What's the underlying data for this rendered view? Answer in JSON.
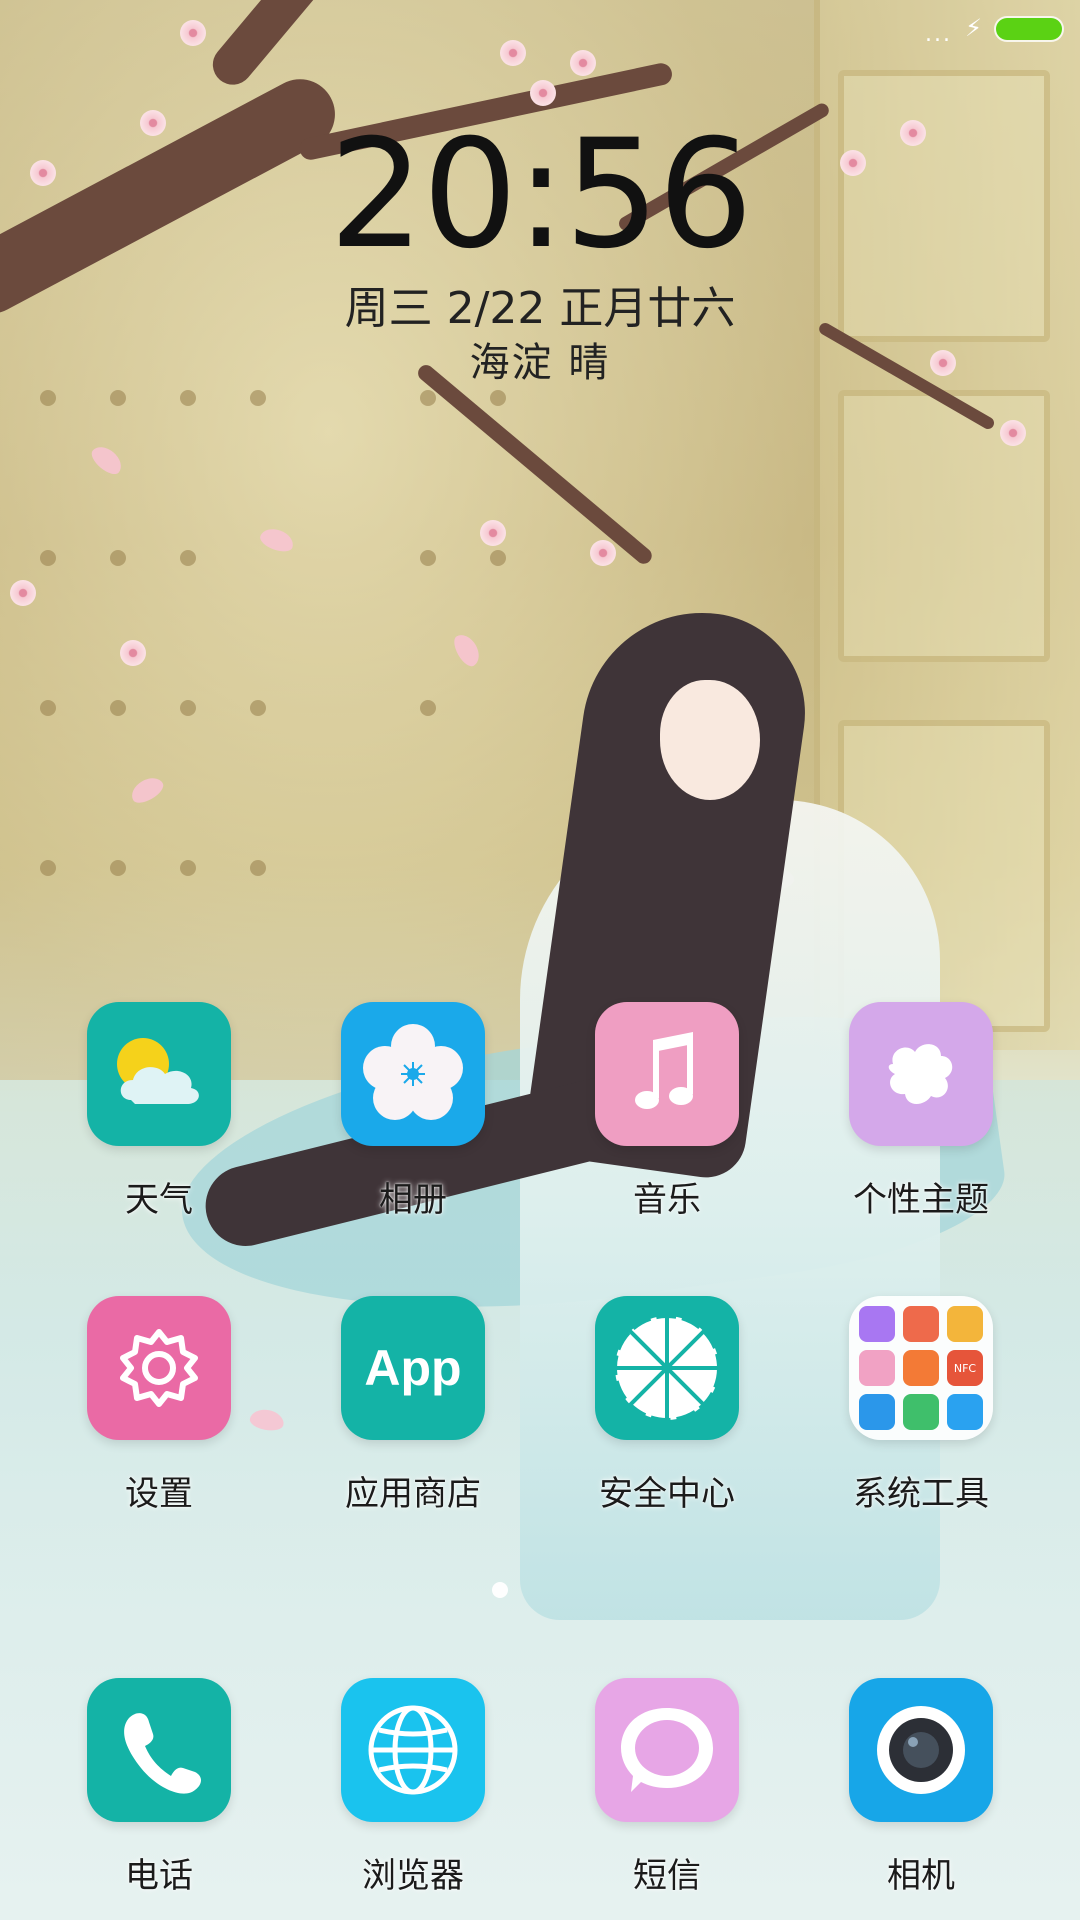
{
  "status_bar": {
    "signal_dots": "...",
    "charging_icon": "bolt-icon",
    "battery_color": "#5bd214"
  },
  "clock_widget": {
    "time": "20:56",
    "date": "周三 2/22 正月廿六",
    "location_weather": "海淀  晴"
  },
  "apps": {
    "row1": [
      {
        "label": "天气",
        "icon": "weather-icon",
        "color": "#14b3a6"
      },
      {
        "label": "相册",
        "icon": "gallery-icon",
        "color": "#1aa9ea"
      },
      {
        "label": "音乐",
        "icon": "music-icon",
        "color": "#ef9ec2"
      },
      {
        "label": "个性主题",
        "icon": "themes-icon",
        "color": "#d4a8ea"
      }
    ],
    "row2": [
      {
        "label": "设置",
        "icon": "settings-icon",
        "color": "#ea6aa5"
      },
      {
        "label": "应用商店",
        "icon_text": "App",
        "icon": "app-store-icon",
        "color": "#14b3a6"
      },
      {
        "label": "安全中心",
        "icon": "security-icon",
        "color": "#14b3a6"
      },
      {
        "label": "系统工具",
        "icon": "folder-icon",
        "color": "#ffffff"
      }
    ],
    "dock": [
      {
        "label": "电话",
        "icon": "phone-icon",
        "color": "#14b3a6"
      },
      {
        "label": "浏览器",
        "icon": "browser-icon",
        "color": "#1ac3ee"
      },
      {
        "label": "短信",
        "icon": "messages-icon",
        "color": "#e7a6e6"
      },
      {
        "label": "相机",
        "icon": "camera-icon",
        "color": "#17a6e8"
      }
    ]
  },
  "folder_mini_icons": [
    {
      "icon": "mi-icon",
      "color": "#a877f2"
    },
    {
      "icon": "stats-icon",
      "color": "#ee6a4b"
    },
    {
      "icon": "layers-icon",
      "color": "#f3b53b"
    },
    {
      "icon": "mic-icon",
      "color": "#f1a2c4"
    },
    {
      "icon": "record-icon",
      "color": "#f37a36"
    },
    {
      "icon": "nfc-icon",
      "color": "#e6553a",
      "text": "NFC"
    },
    {
      "icon": "compass-icon",
      "color": "#2b97ea"
    },
    {
      "icon": "radar-icon",
      "color": "#3fbf6b"
    },
    {
      "icon": "scanner-icon",
      "color": "#2aa2f0"
    }
  ]
}
